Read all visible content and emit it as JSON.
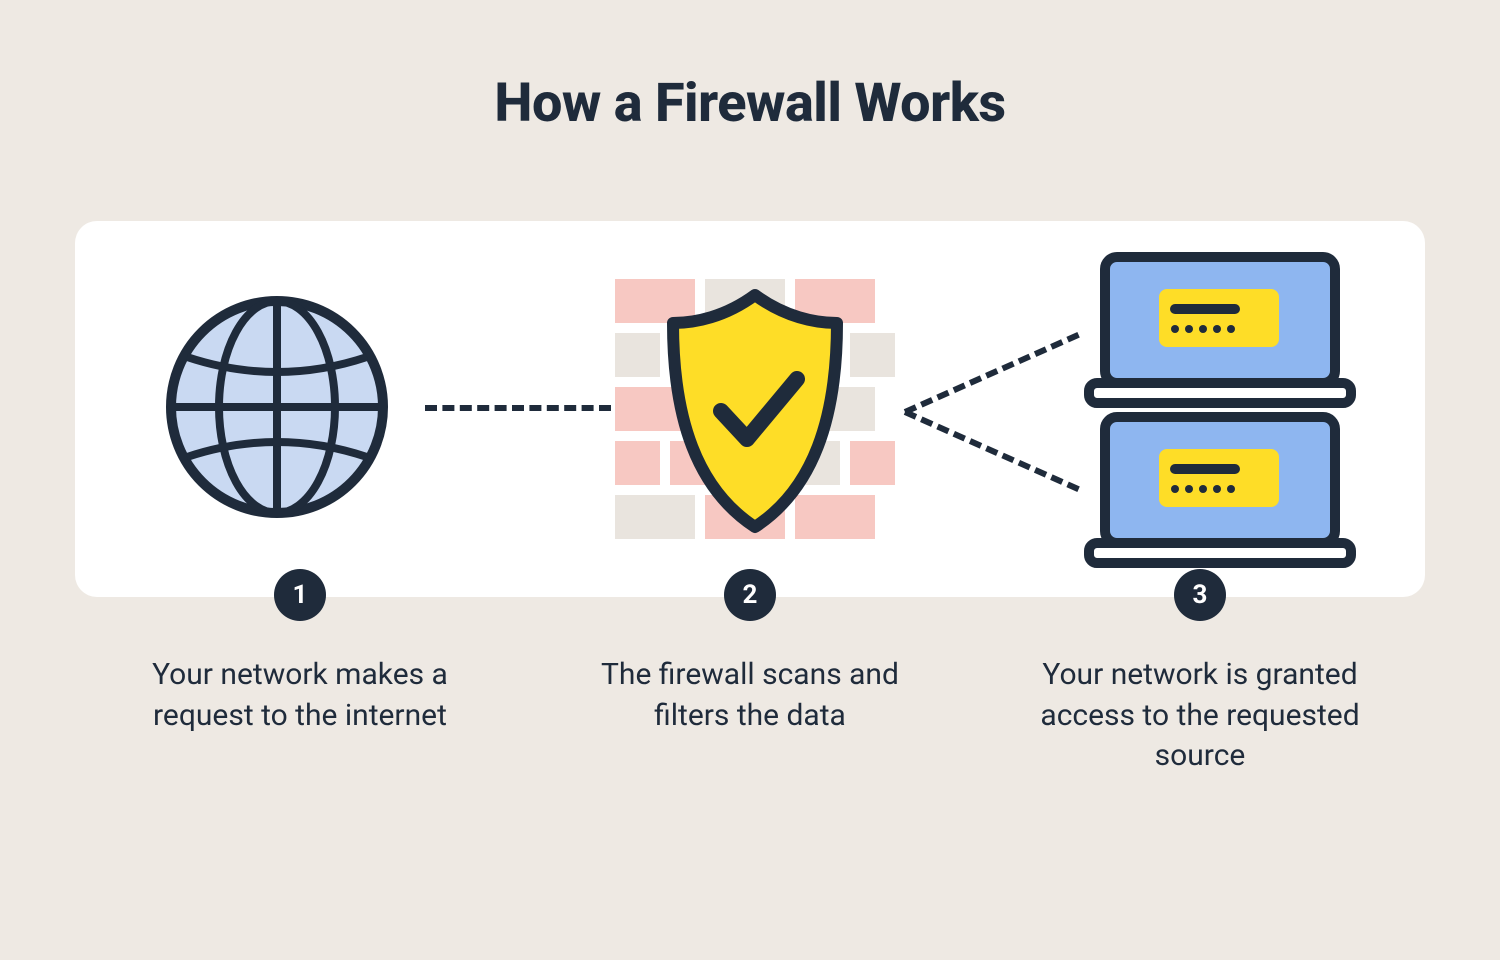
{
  "title": "How a Firewall Works",
  "steps": [
    {
      "num": "1",
      "text": "Your network makes a request to the internet"
    },
    {
      "num": "2",
      "text": "The firewall scans and filters the data"
    },
    {
      "num": "3",
      "text": "Your network is granted access to the requested source"
    }
  ],
  "icons": {
    "globe": "globe-icon",
    "firewall": "shield-check-icon",
    "laptops": "laptop-stack-icon"
  },
  "colors": {
    "background": "#eee9e3",
    "card": "#ffffff",
    "ink": "#1f2b3b",
    "globe_fill": "#c9d9f2",
    "shield_fill": "#fedd27",
    "brick_a": "#f7c8c2",
    "brick_b": "#e9e4de",
    "laptop_screen": "#8eb6f0",
    "laptop_window": "#fedd27"
  }
}
